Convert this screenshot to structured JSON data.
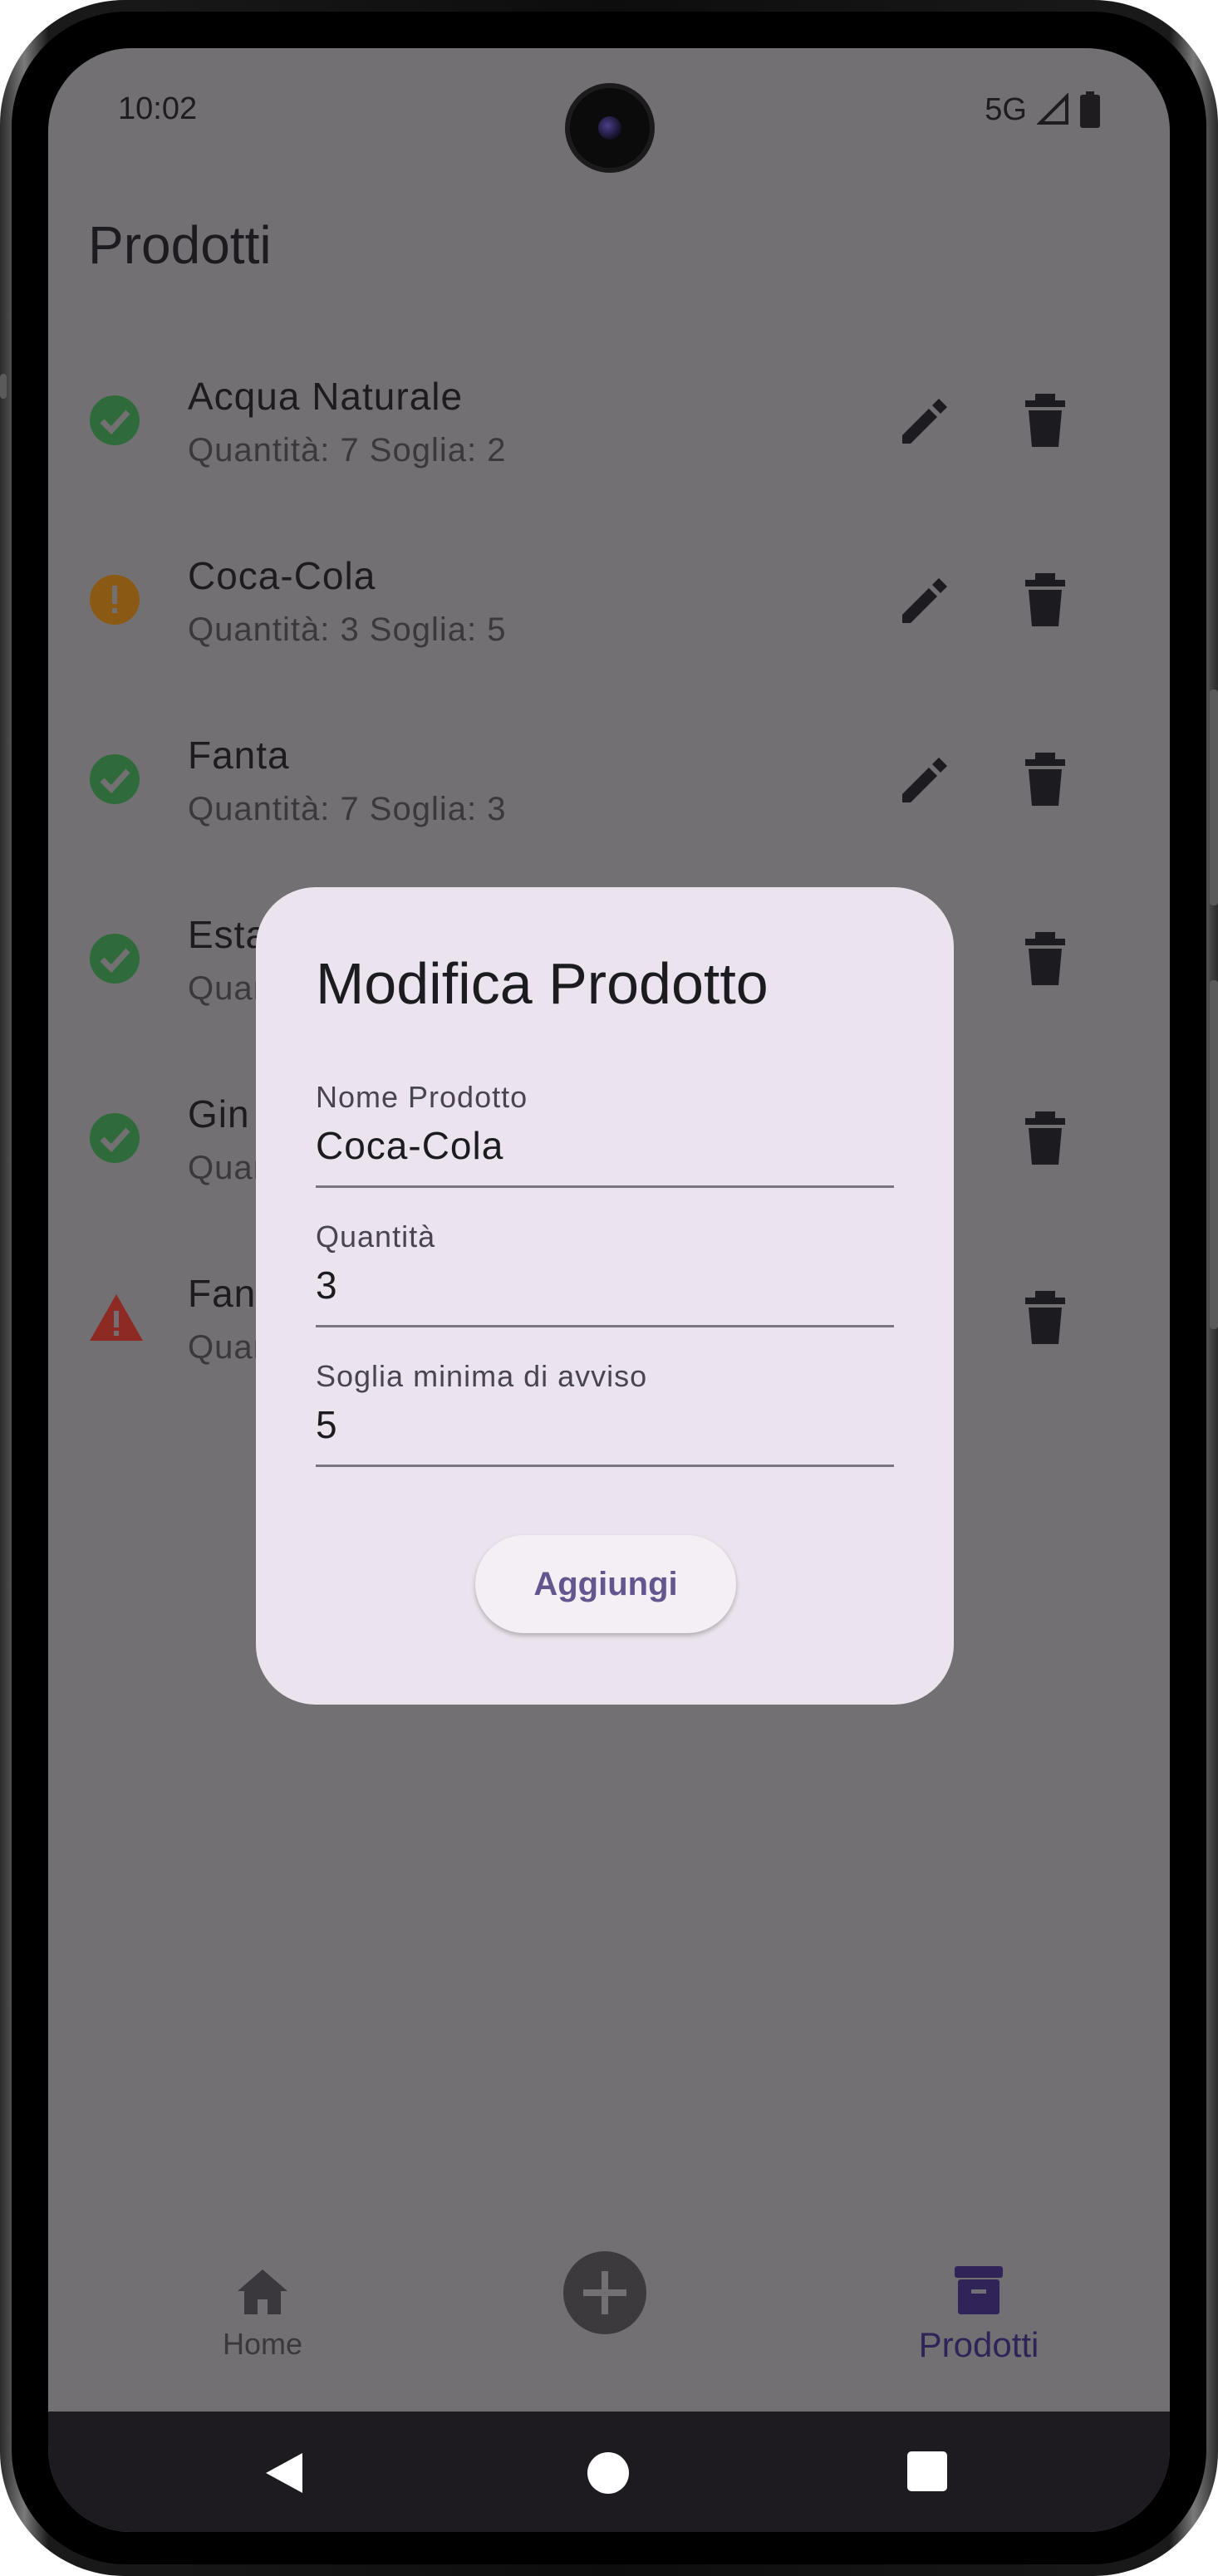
{
  "status_bar": {
    "time": "10:02",
    "network": "5G"
  },
  "page": {
    "title": "Prodotti"
  },
  "products": [
    {
      "name": "Acqua Naturale",
      "details": "Quantità: 7 Soglia: 2",
      "status": "ok"
    },
    {
      "name": "Coca-Cola",
      "details": "Quantità: 3 Soglia: 5",
      "status": "warning"
    },
    {
      "name": "Fanta",
      "details": "Quantità: 7 Soglia: 3",
      "status": "ok"
    },
    {
      "name": "Esta",
      "details": "Quar",
      "status": "ok"
    },
    {
      "name": "Gin",
      "details": "Quar",
      "status": "ok"
    },
    {
      "name": "Fan",
      "details": "Quar",
      "status": "critical"
    }
  ],
  "dialog": {
    "title": "Modifica Prodotto",
    "fields": [
      {
        "label": "Nome Prodotto",
        "value": "Coca-Cola"
      },
      {
        "label": "Quantità",
        "value": "3"
      },
      {
        "label": "Soglia minima di avviso",
        "value": "5"
      }
    ],
    "submit_label": "Aggiungi"
  },
  "bottom_nav": {
    "home_label": "Home",
    "products_label": "Prodotti"
  },
  "colors": {
    "ok": "#2f6b3a",
    "warning": "#8a5a14",
    "critical": "#8e2a24",
    "accent": "#65558f",
    "scrim": "#737073",
    "dialog_bg": "#ebe4ee"
  },
  "icons": {
    "status_ok": "check-circle-icon",
    "status_warning": "exclamation-circle-icon",
    "status_critical": "warning-triangle-icon",
    "edit": "pencil-icon",
    "delete": "trash-icon",
    "home": "home-icon",
    "add": "plus-icon",
    "products": "archive-icon"
  }
}
